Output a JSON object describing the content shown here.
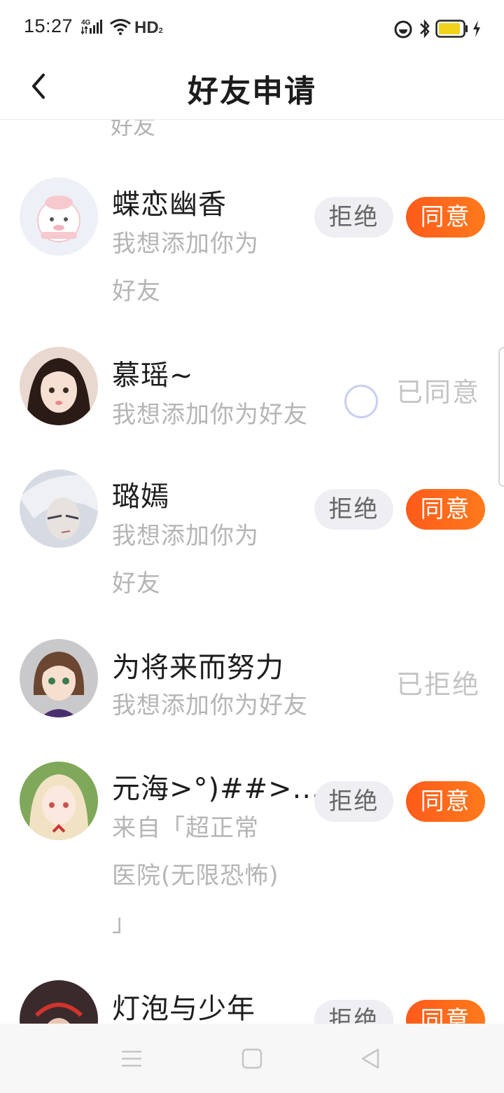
{
  "status_bar": {
    "time": "15:27",
    "network": "4G",
    "hd": "HD",
    "hd_sub": "2"
  },
  "header": {
    "title": "好友申请",
    "back_icon": "chevron-left-icon"
  },
  "list": {
    "top_partial_text": "好友",
    "items": [
      {
        "name": "蝶恋幽香",
        "message": "我想添加你为好友",
        "state": "pending",
        "reject_label": "拒绝",
        "accept_label": "同意"
      },
      {
        "name": "慕瑶~",
        "message": "我想添加你为好友",
        "state": "accepted",
        "status_label": "已同意"
      },
      {
        "name": "璐嫣",
        "message": "我想添加你为好友",
        "state": "pending",
        "reject_label": "拒绝",
        "accept_label": "同意"
      },
      {
        "name": "为将来而努力",
        "message": "我想添加你为好友",
        "state": "rejected",
        "status_label": "已拒绝"
      },
      {
        "name": "元海>°)##>...",
        "message": "来自「超正常医院(无限恐怖) 」",
        "state": "pending",
        "reject_label": "拒绝",
        "accept_label": "同意"
      },
      {
        "name": "灯泡与少年",
        "message": "",
        "state": "pending",
        "reject_label": "拒绝",
        "accept_label": "同意"
      }
    ]
  },
  "colors": {
    "accent": "#ff6a1a",
    "reject_bg": "#eeeef3",
    "muted_text": "#b5b5b5"
  },
  "system_nav": {
    "icons": [
      "menu-icon",
      "home-square-icon",
      "back-triangle-icon"
    ]
  }
}
